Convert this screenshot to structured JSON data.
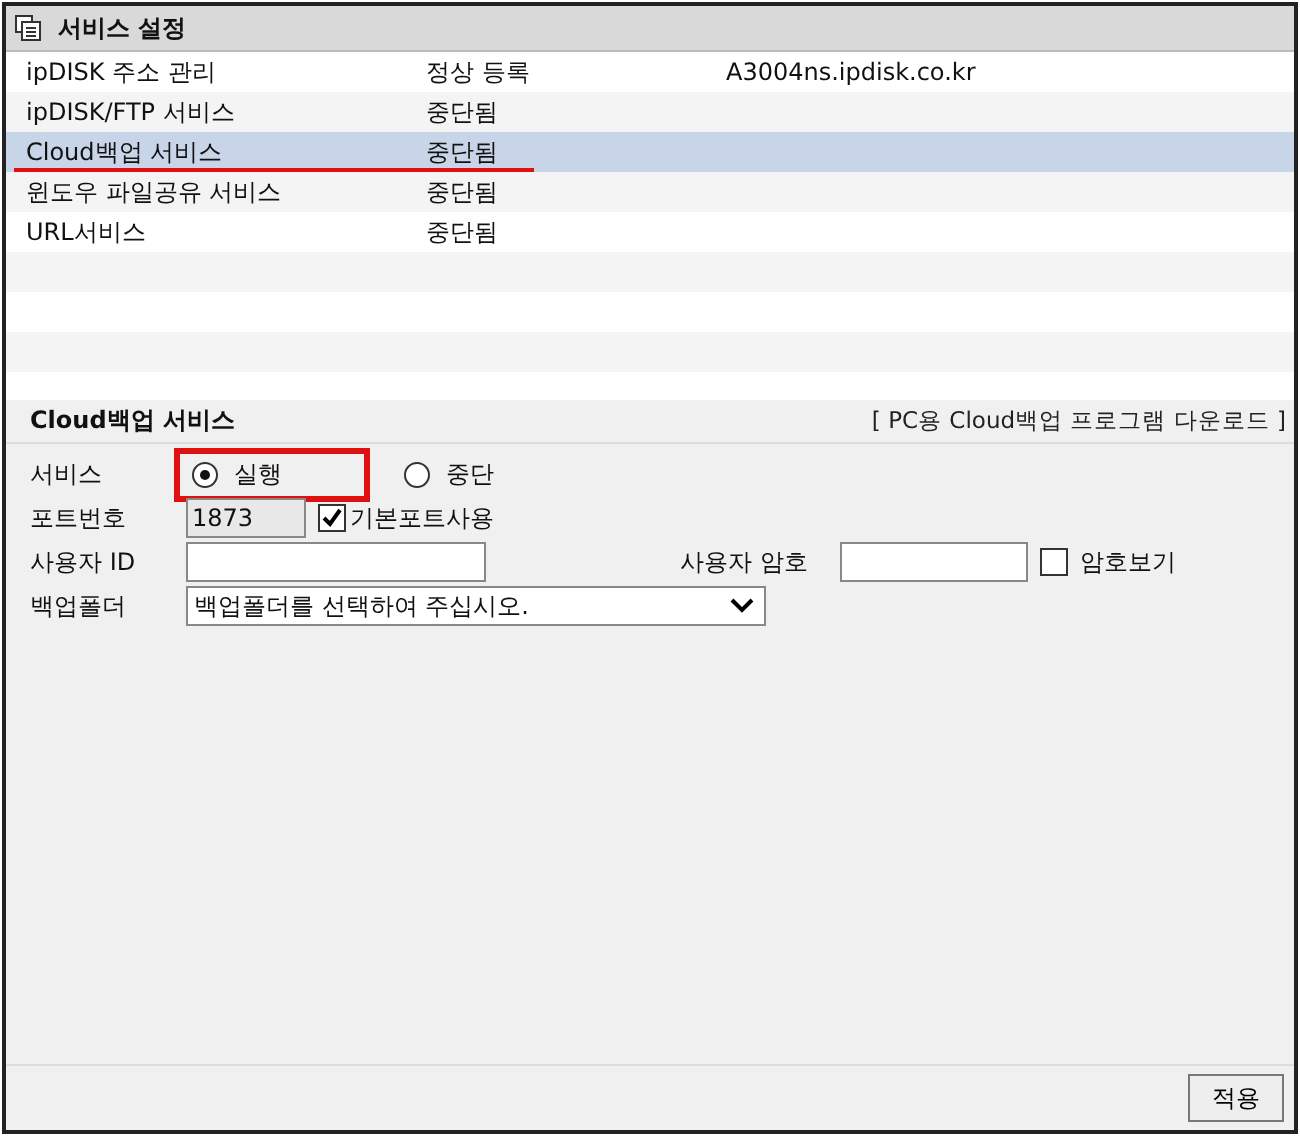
{
  "panel": {
    "title": "서비스 설정"
  },
  "services": [
    {
      "name": "ipDISK 주소 관리",
      "status": "정상 등록",
      "address": "A3004ns.ipdisk.co.kr",
      "selected": false,
      "underlined": false
    },
    {
      "name": "ipDISK/FTP 서비스",
      "status": "중단됨",
      "selected": false,
      "underlined": false
    },
    {
      "name": "Cloud백업 서비스",
      "status": "중단됨",
      "selected": true,
      "underlined": true
    },
    {
      "name": "윈도우 파일공유 서비스",
      "status": "중단됨",
      "selected": false,
      "underlined": false
    },
    {
      "name": "URL서비스",
      "status": "중단됨",
      "selected": false,
      "underlined": false
    }
  ],
  "detail": {
    "title": "Cloud백업 서비스",
    "download_link": "[ PC용 Cloud백업 프로그램 다운로드 ]",
    "service_label": "서비스",
    "service_options": [
      {
        "label": "실행",
        "selected": true,
        "boxed": true
      },
      {
        "label": "중단",
        "selected": false,
        "boxed": false
      }
    ],
    "port_label": "포트번호",
    "port_value": "1873",
    "default_port": {
      "label": "기본포트사용",
      "checked": true
    },
    "user_id_label": "사용자 ID",
    "password_label": "사용자 암호",
    "show_password": {
      "label": "암호보기",
      "checked": false
    },
    "folder_label": "백업폴더",
    "folder_value": "백업폴더를 선택하여 주십시오."
  },
  "apply_button": "적용"
}
